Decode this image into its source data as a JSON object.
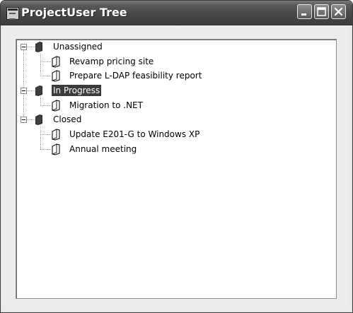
{
  "window": {
    "title": "ProjectUser Tree"
  },
  "icons": {
    "app": "app-icon",
    "minimize": "minimize-icon",
    "maximize": "maximize-icon",
    "close": "close-icon",
    "node": "book-icon",
    "expander": "collapse-icon"
  },
  "tree": {
    "groups": [
      {
        "label": "Unassigned",
        "expanded": true,
        "selected": false,
        "items": [
          {
            "label": "Revamp pricing site"
          },
          {
            "label": "Prepare L-DAP feasibility report"
          }
        ]
      },
      {
        "label": "In Progress",
        "expanded": true,
        "selected": true,
        "items": [
          {
            "label": "Migration to .NET"
          }
        ]
      },
      {
        "label": "Closed",
        "expanded": true,
        "selected": false,
        "items": [
          {
            "label": "Update E201-G to Windows XP"
          },
          {
            "label": "Annual meeting"
          }
        ]
      }
    ]
  },
  "colors": {
    "title_bar": "#474747",
    "selection": "#3c3c3c",
    "tree_background": "#ffffff"
  }
}
